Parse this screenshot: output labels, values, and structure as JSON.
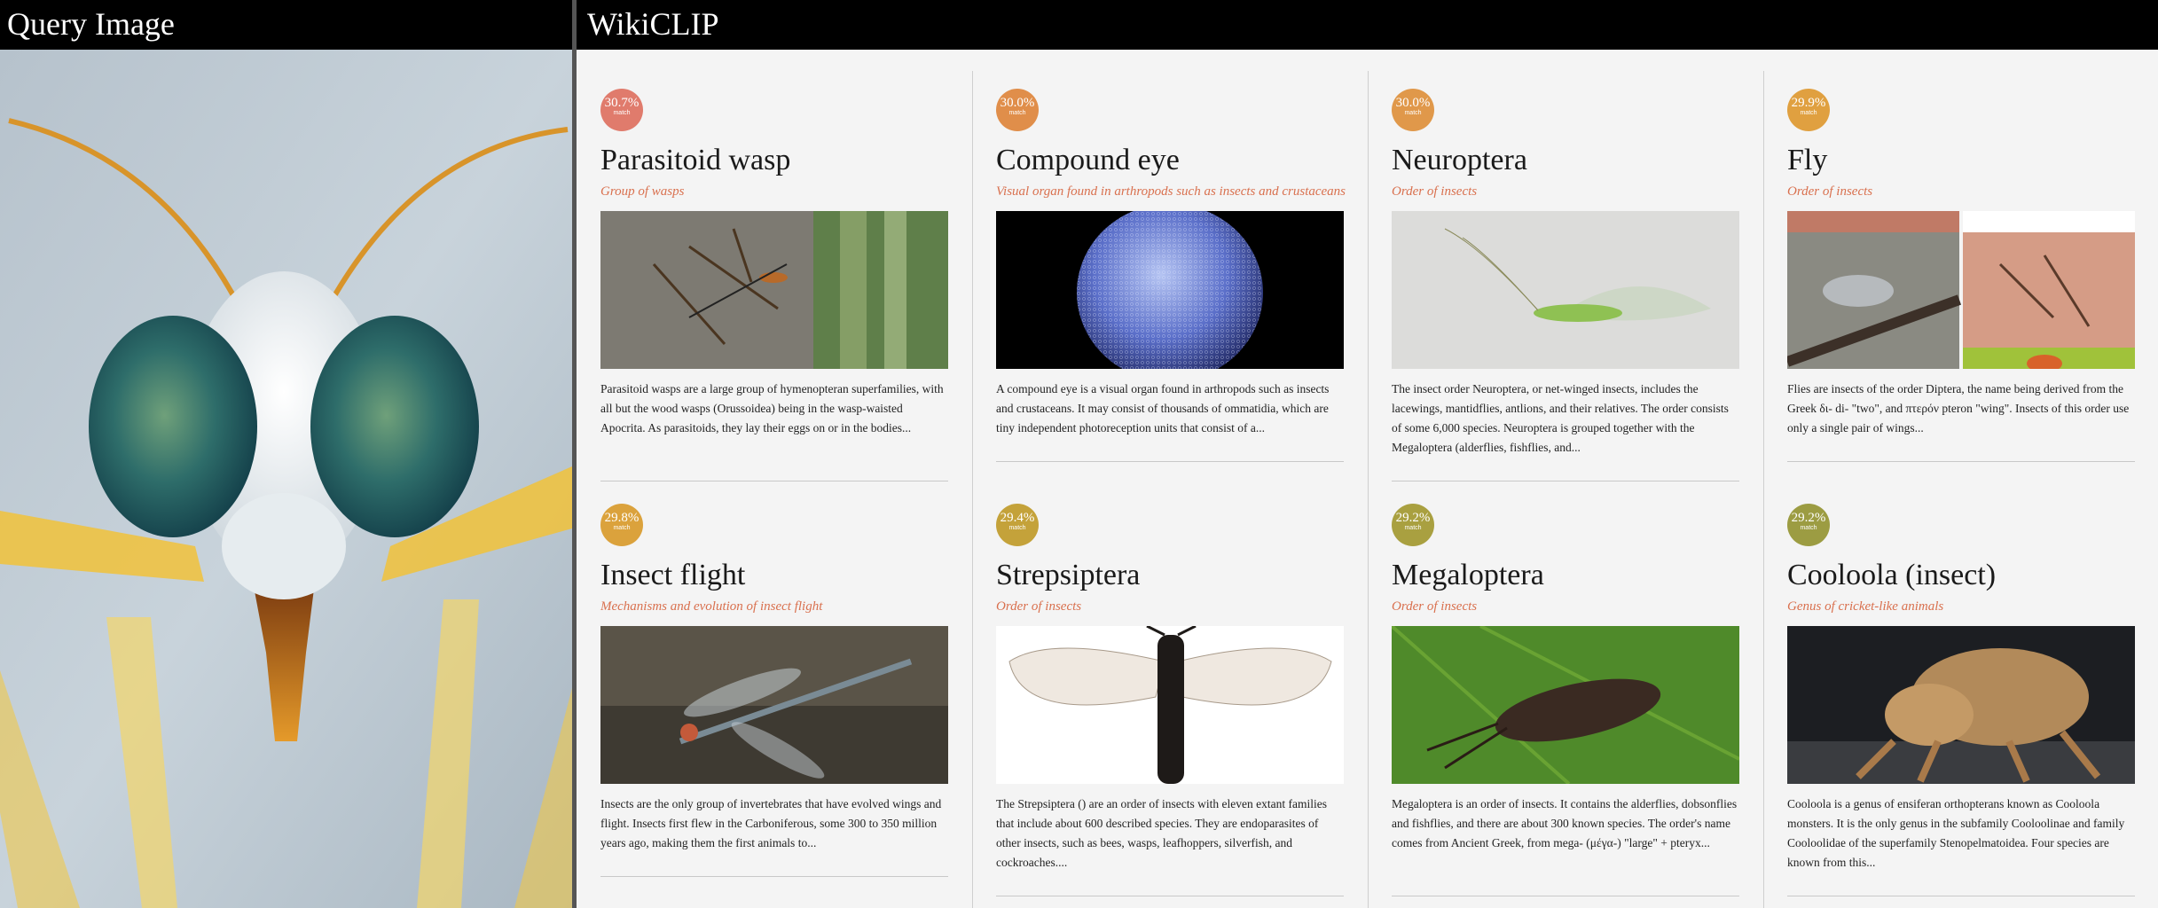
{
  "left": {
    "title": "Query Image"
  },
  "right": {
    "title": "WikiCLIP"
  },
  "badge_label": "match",
  "colors": {
    "header_bg": "#000000",
    "subtitle": "#d9704e",
    "page_bg": "#f4f4f4"
  },
  "results": [
    {
      "score": "30.7%",
      "title": "Parasitoid wasp",
      "subtitle": "Group of wasps",
      "badge_color": "#e07b6c",
      "description": "Parasitoid wasps are a large group of hymenopteran superfamilies, with all but the wood wasps (Orussoidea) being in the wasp-waisted Apocrita. As parasitoids, they lay their eggs on or in the bodies..."
    },
    {
      "score": "30.0%",
      "title": "Compound eye",
      "subtitle": "Visual organ found in arthropods such as insects and crustaceans",
      "badge_color": "#e08e4a",
      "description": "A compound eye is a visual organ found in arthropods such as insects and crustaceans. It may consist of thousands of ommatidia, which are tiny independent photoreception units that consist of a..."
    },
    {
      "score": "30.0%",
      "title": "Neuroptera",
      "subtitle": "Order of insects",
      "badge_color": "#e0984a",
      "description": "The insect order Neuroptera, or net-winged insects, includes the lacewings, mantidflies, antlions, and their relatives. The order consists of some 6,000 species. Neuroptera is grouped together with the Megaloptera (alderflies, fishflies, and..."
    },
    {
      "score": "29.9%",
      "title": "Fly",
      "subtitle": "Order of insects",
      "badge_color": "#e0a040",
      "description": "Flies are insects of the order Diptera, the name being derived from the Greek δι- di- \"two\", and πτερόν pteron \"wing\". Insects of this order use only a single pair of wings..."
    },
    {
      "score": "29.8%",
      "title": "Insect flight",
      "subtitle": "Mechanisms and evolution of insect flight",
      "badge_color": "#dba23c",
      "description": "Insects are the only group of invertebrates that have evolved wings and flight. Insects first flew in the Carboniferous, some 300 to 350 million years ago, making them the first animals to..."
    },
    {
      "score": "29.4%",
      "title": "Strepsiptera",
      "subtitle": "Order of insects",
      "badge_color": "#c4a23a",
      "description": "The Strepsiptera () are an order of insects with eleven extant families that include about 600 described species. They are endoparasites of other insects, such as bees, wasps, leafhoppers, silverfish, and cockroaches...."
    },
    {
      "score": "29.2%",
      "title": "Megaloptera",
      "subtitle": "Order of insects",
      "badge_color": "#a9a040",
      "description": "Megaloptera is an order of insects. It contains the alderflies, dobsonflies and fishflies, and there are about 300 known species. The order's name comes from Ancient Greek, from mega- (μέγα-) \"large\" + pteryx..."
    },
    {
      "score": "29.2%",
      "title": "Cooloola (insect)",
      "subtitle": "Genus of cricket-like animals",
      "badge_color": "#9c9c42",
      "description": "Cooloola is a genus of ensiferan orthopterans known as Cooloola monsters. It is the only genus in the subfamily Cooloolinae and family Cooloolidae of the superfamily Stenopelmatoidea. Four species are known from this..."
    }
  ]
}
